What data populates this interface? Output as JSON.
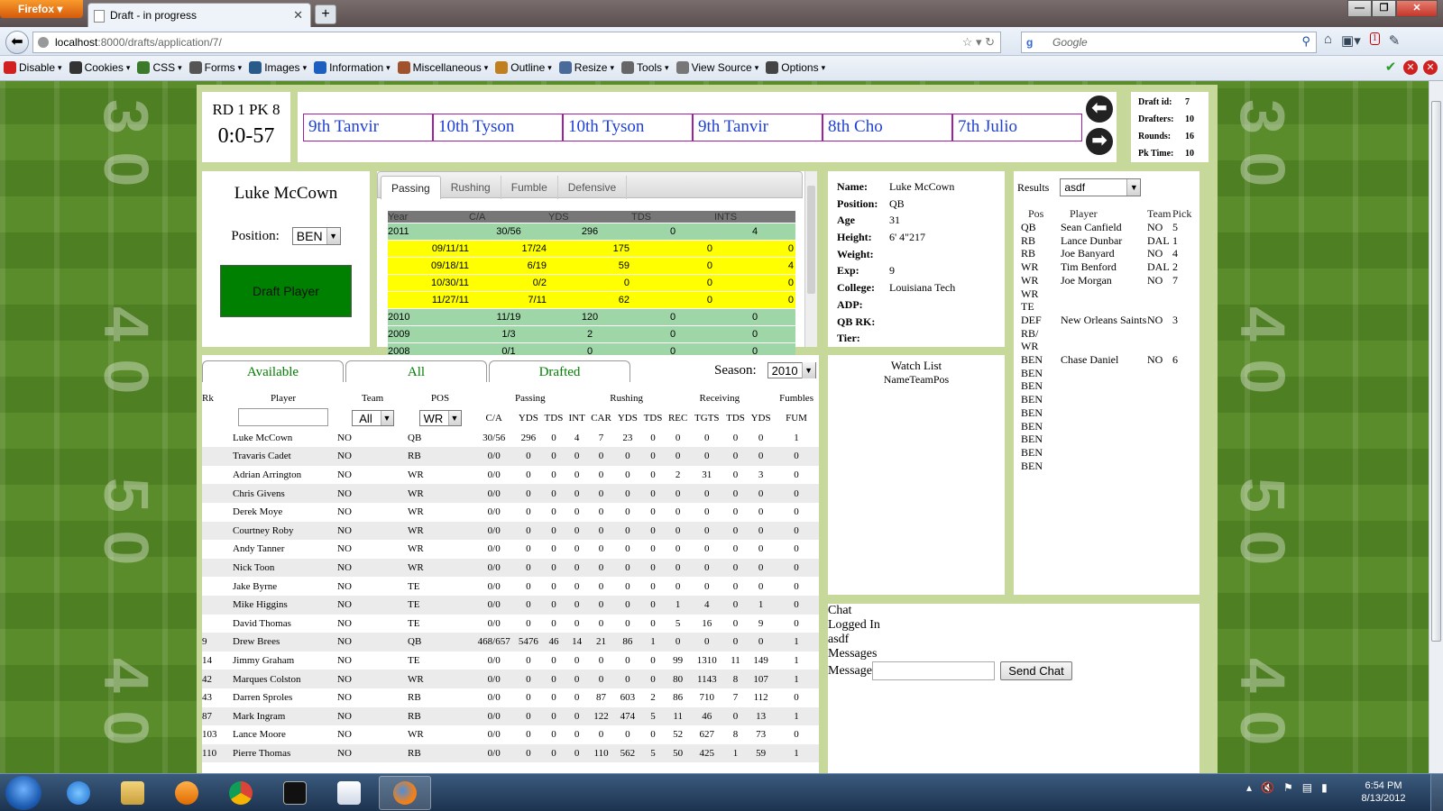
{
  "browser": {
    "menu_button": "Firefox",
    "tab_title": "Draft - in progress",
    "new_tab": "+",
    "url_host": "localhost",
    "url_path": ":8000/drafts/application/7/",
    "search_placeholder": "Google",
    "badge_count": "1",
    "window_controls": [
      "—",
      "❐",
      "✕"
    ]
  },
  "devtoolbar": {
    "items": [
      {
        "label": "Disable",
        "color": "#d02020"
      },
      {
        "label": "Cookies",
        "color": "#333333"
      },
      {
        "label": "CSS",
        "color": "#3b7a2a"
      },
      {
        "label": "Forms",
        "color": "#555555"
      },
      {
        "label": "Images",
        "color": "#2a5a8a"
      },
      {
        "label": "Information",
        "color": "#1d5fbf"
      },
      {
        "label": "Miscellaneous",
        "color": "#a0522d"
      },
      {
        "label": "Outline",
        "color": "#c08020"
      },
      {
        "label": "Resize",
        "color": "#4a6a9a"
      },
      {
        "label": "Tools",
        "color": "#666666"
      },
      {
        "label": "View Source",
        "color": "#777777"
      },
      {
        "label": "Options",
        "color": "#444444"
      }
    ]
  },
  "draft": {
    "round_pick": "RD 1 PK 8",
    "timer": "0:0-57",
    "queue": [
      "9th Tanvir",
      "10th Tyson",
      "10th Tyson",
      "9th Tanvir",
      "8th Cho",
      "7th Julio"
    ],
    "info": [
      {
        "label": "Draft id:",
        "value": "7"
      },
      {
        "label": "Drafters:",
        "value": "10"
      },
      {
        "label": "Rounds:",
        "value": "16"
      },
      {
        "label": "Pk Time:",
        "value": "10"
      }
    ]
  },
  "player_card": {
    "name": "Luke McCown",
    "position_label": "Position:",
    "position_value": "BEN",
    "draft_button": "Draft Player"
  },
  "stats_tabs": {
    "tabs": [
      "Passing",
      "Rushing",
      "Fumble",
      "Defensive"
    ],
    "headers": [
      "Year",
      "C/A",
      "YDS",
      "TDS",
      "INTS"
    ],
    "rows": [
      {
        "kind": "yr",
        "c": [
          "2011",
          "30/56",
          "296",
          "0",
          "4"
        ]
      },
      {
        "kind": "gm",
        "c": [
          "09/11/11",
          "17/24",
          "175",
          "0",
          "0"
        ]
      },
      {
        "kind": "gm",
        "c": [
          "09/18/11",
          "6/19",
          "59",
          "0",
          "4"
        ]
      },
      {
        "kind": "gm",
        "c": [
          "10/30/11",
          "0/2",
          "0",
          "0",
          "0"
        ]
      },
      {
        "kind": "gm",
        "c": [
          "11/27/11",
          "7/11",
          "62",
          "0",
          "0"
        ]
      },
      {
        "kind": "yr",
        "c": [
          "2010",
          "11/19",
          "120",
          "0",
          "0"
        ]
      },
      {
        "kind": "yr",
        "c": [
          "2009",
          "1/3",
          "2",
          "0",
          "0"
        ]
      },
      {
        "kind": "yr",
        "c": [
          "2008",
          "0/1",
          "0",
          "0",
          "0"
        ]
      }
    ]
  },
  "player_detail": [
    {
      "label": "Name:",
      "value": "Luke McCown"
    },
    {
      "label": "Position:",
      "value": "QB"
    },
    {
      "label": "Age",
      "value": "31"
    },
    {
      "label": "Height:",
      "value": "6' 4\"217"
    },
    {
      "label": "Weight:",
      "value": ""
    },
    {
      "label": "Exp:",
      "value": "9"
    },
    {
      "label": "College:",
      "value": "Louisiana Tech"
    },
    {
      "label": "ADP:",
      "value": ""
    },
    {
      "label": "QB RK:",
      "value": ""
    },
    {
      "label": "Tier:",
      "value": ""
    }
  ],
  "results": {
    "label": "Results",
    "selected": "asdf",
    "headers": [
      "Pos",
      "Player",
      "Team",
      "Pick"
    ],
    "rows": [
      {
        "pos": "QB",
        "player": "Sean Canfield",
        "team": "NO",
        "pick": "5"
      },
      {
        "pos": "RB",
        "player": "Lance Dunbar",
        "team": "DAL",
        "pick": "1"
      },
      {
        "pos": "RB",
        "player": "Joe Banyard",
        "team": "NO",
        "pick": "4"
      },
      {
        "pos": "WR",
        "player": "Tim Benford",
        "team": "DAL",
        "pick": "2"
      },
      {
        "pos": "WR",
        "player": "Joe Morgan",
        "team": "NO",
        "pick": "7"
      },
      {
        "pos": "WR",
        "player": "",
        "team": "",
        "pick": ""
      },
      {
        "pos": "TE",
        "player": "",
        "team": "",
        "pick": ""
      },
      {
        "pos": "DEF",
        "player": "New Orleans Saints",
        "team": "NO",
        "pick": "3"
      },
      {
        "pos": "RB/ WR",
        "player": "",
        "team": "",
        "pick": ""
      },
      {
        "pos": "BEN",
        "player": "Chase Daniel",
        "team": "NO",
        "pick": "6"
      },
      {
        "pos": "BEN",
        "player": "",
        "team": "",
        "pick": ""
      },
      {
        "pos": "BEN",
        "player": "",
        "team": "",
        "pick": ""
      },
      {
        "pos": "BEN",
        "player": "",
        "team": "",
        "pick": ""
      },
      {
        "pos": "BEN",
        "player": "",
        "team": "",
        "pick": ""
      },
      {
        "pos": "BEN",
        "player": "",
        "team": "",
        "pick": ""
      },
      {
        "pos": "BEN",
        "player": "",
        "team": "",
        "pick": ""
      },
      {
        "pos": "BEN",
        "player": "",
        "team": "",
        "pick": ""
      },
      {
        "pos": "BEN",
        "player": "",
        "team": "",
        "pick": ""
      }
    ]
  },
  "watch_list": {
    "title": "Watch List",
    "columns": "NameTeamPos"
  },
  "player_list": {
    "tabs": [
      "Available",
      "All",
      "Drafted"
    ],
    "season_label": "Season:",
    "season_value": "2010",
    "group_headers": {
      "rk": "Rk",
      "player": "Player",
      "team": "Team",
      "pos": "POS",
      "passing": "Passing",
      "rushing": "Rushing",
      "receiving": "Receiving",
      "fumbles": "Fumbles"
    },
    "team_filter": "All",
    "pos_filter": "WR",
    "sub_headers": [
      "C/A",
      "YDS",
      "TDS",
      "INT",
      "CAR",
      "YDS",
      "TDS",
      "REC",
      "TGTS",
      "TDS",
      "YDS",
      "FUM"
    ],
    "rows": [
      [
        "",
        "Luke McCown",
        "NO",
        "QB",
        "30/56",
        "296",
        "0",
        "4",
        "7",
        "23",
        "0",
        "0",
        "0",
        "0",
        "0",
        "1"
      ],
      [
        "",
        "Travaris Cadet",
        "NO",
        "RB",
        "0/0",
        "0",
        "0",
        "0",
        "0",
        "0",
        "0",
        "0",
        "0",
        "0",
        "0",
        "0"
      ],
      [
        "",
        "Adrian Arrington",
        "NO",
        "WR",
        "0/0",
        "0",
        "0",
        "0",
        "0",
        "0",
        "0",
        "2",
        "31",
        "0",
        "3",
        "0"
      ],
      [
        "",
        "Chris Givens",
        "NO",
        "WR",
        "0/0",
        "0",
        "0",
        "0",
        "0",
        "0",
        "0",
        "0",
        "0",
        "0",
        "0",
        "0"
      ],
      [
        "",
        "Derek Moye",
        "NO",
        "WR",
        "0/0",
        "0",
        "0",
        "0",
        "0",
        "0",
        "0",
        "0",
        "0",
        "0",
        "0",
        "0"
      ],
      [
        "",
        "Courtney Roby",
        "NO",
        "WR",
        "0/0",
        "0",
        "0",
        "0",
        "0",
        "0",
        "0",
        "0",
        "0",
        "0",
        "0",
        "0"
      ],
      [
        "",
        "Andy Tanner",
        "NO",
        "WR",
        "0/0",
        "0",
        "0",
        "0",
        "0",
        "0",
        "0",
        "0",
        "0",
        "0",
        "0",
        "0"
      ],
      [
        "",
        "Nick Toon",
        "NO",
        "WR",
        "0/0",
        "0",
        "0",
        "0",
        "0",
        "0",
        "0",
        "0",
        "0",
        "0",
        "0",
        "0"
      ],
      [
        "",
        "Jake Byrne",
        "NO",
        "TE",
        "0/0",
        "0",
        "0",
        "0",
        "0",
        "0",
        "0",
        "0",
        "0",
        "0",
        "0",
        "0"
      ],
      [
        "",
        "Mike Higgins",
        "NO",
        "TE",
        "0/0",
        "0",
        "0",
        "0",
        "0",
        "0",
        "0",
        "1",
        "4",
        "0",
        "1",
        "0"
      ],
      [
        "",
        "David Thomas",
        "NO",
        "TE",
        "0/0",
        "0",
        "0",
        "0",
        "0",
        "0",
        "0",
        "5",
        "16",
        "0",
        "9",
        "0"
      ],
      [
        "9",
        "Drew Brees",
        "NO",
        "QB",
        "468/657",
        "5476",
        "46",
        "14",
        "21",
        "86",
        "1",
        "0",
        "0",
        "0",
        "0",
        "1"
      ],
      [
        "14",
        "Jimmy Graham",
        "NO",
        "TE",
        "0/0",
        "0",
        "0",
        "0",
        "0",
        "0",
        "0",
        "99",
        "1310",
        "11",
        "149",
        "1"
      ],
      [
        "42",
        "Marques Colston",
        "NO",
        "WR",
        "0/0",
        "0",
        "0",
        "0",
        "0",
        "0",
        "0",
        "80",
        "1143",
        "8",
        "107",
        "1"
      ],
      [
        "43",
        "Darren Sproles",
        "NO",
        "RB",
        "0/0",
        "0",
        "0",
        "0",
        "87",
        "603",
        "2",
        "86",
        "710",
        "7",
        "112",
        "0"
      ],
      [
        "87",
        "Mark Ingram",
        "NO",
        "RB",
        "0/0",
        "0",
        "0",
        "0",
        "122",
        "474",
        "5",
        "11",
        "46",
        "0",
        "13",
        "1"
      ],
      [
        "103",
        "Lance Moore",
        "NO",
        "WR",
        "0/0",
        "0",
        "0",
        "0",
        "0",
        "0",
        "0",
        "52",
        "627",
        "8",
        "73",
        "0"
      ],
      [
        "110",
        "Pierre Thomas",
        "NO",
        "RB",
        "0/0",
        "0",
        "0",
        "0",
        "110",
        "562",
        "5",
        "50",
        "425",
        "1",
        "59",
        "1"
      ]
    ]
  },
  "chat": {
    "title": "Chat",
    "logged_in": "Logged In",
    "user": "asdf",
    "messages": "Messages",
    "message_label": "Message",
    "send": "Send Chat"
  },
  "field_yards": [
    "3 0",
    "4 0",
    "5 0",
    "4 0"
  ],
  "taskbar": {
    "time": "6:54 PM",
    "date": "8/13/2012"
  }
}
